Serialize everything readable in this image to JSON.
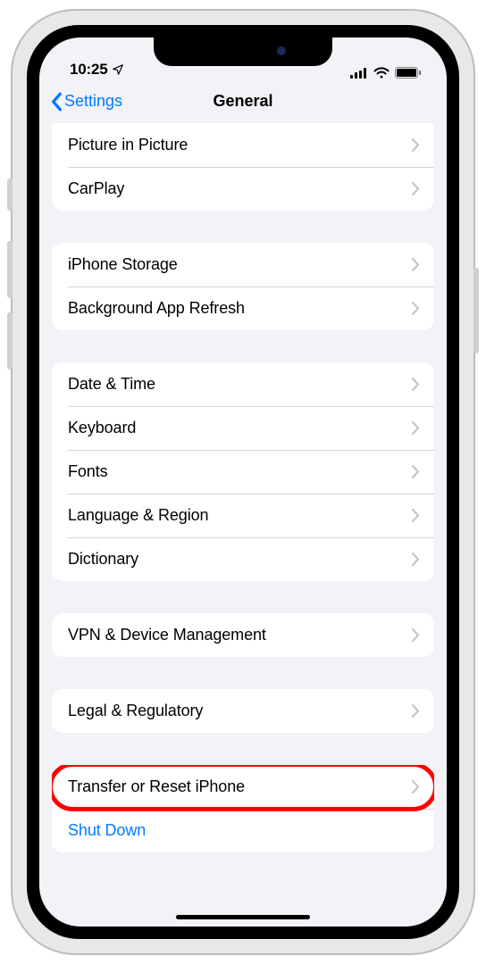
{
  "status": {
    "time": "10:25",
    "location_icon": "location-arrow"
  },
  "nav": {
    "back_label": "Settings",
    "title": "General"
  },
  "groups": [
    {
      "rows": [
        {
          "label": "Picture in Picture",
          "chevron": true
        },
        {
          "label": "CarPlay",
          "chevron": true
        }
      ]
    },
    {
      "rows": [
        {
          "label": "iPhone Storage",
          "chevron": true
        },
        {
          "label": "Background App Refresh",
          "chevron": true
        }
      ]
    },
    {
      "rows": [
        {
          "label": "Date & Time",
          "chevron": true
        },
        {
          "label": "Keyboard",
          "chevron": true
        },
        {
          "label": "Fonts",
          "chevron": true
        },
        {
          "label": "Language & Region",
          "chevron": true
        },
        {
          "label": "Dictionary",
          "chevron": true
        }
      ]
    },
    {
      "rows": [
        {
          "label": "VPN & Device Management",
          "chevron": true
        }
      ]
    },
    {
      "rows": [
        {
          "label": "Legal & Regulatory",
          "chevron": true
        }
      ]
    },
    {
      "rows": [
        {
          "label": "Transfer or Reset iPhone",
          "chevron": true,
          "highlighted": true
        },
        {
          "label": "Shut Down",
          "chevron": false,
          "blue": true
        }
      ]
    }
  ]
}
